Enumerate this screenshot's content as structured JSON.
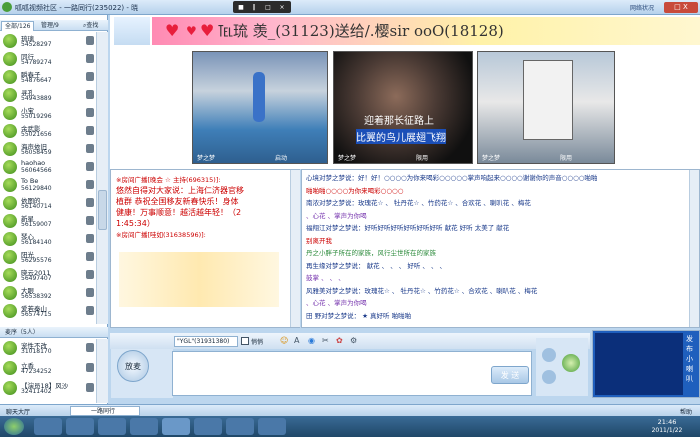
{
  "window": {
    "title": "呱呱视频社区 - 一路同行(235022) - 晓",
    "net_status": "网络状况",
    "max_label": "□ X"
  },
  "left_tabs": {
    "all": "全部/126",
    "manage": "管理/9",
    "search": "查找"
  },
  "users": [
    {
      "name": "琉璃",
      "id": "54528297"
    },
    {
      "name": "同行",
      "id": "54789274"
    },
    {
      "name": "瞬春子",
      "id": "54876647"
    },
    {
      "name": "寻孔",
      "id": "54943889"
    },
    {
      "name": "小宝",
      "id": "55019296"
    },
    {
      "name": "余武影",
      "id": "55021656"
    },
    {
      "name": "海声依旧",
      "id": "56058459"
    },
    {
      "name": "haohao",
      "id": "56064566"
    },
    {
      "name": "To Be",
      "id": "56129840"
    },
    {
      "name": "依图的",
      "id": "56140714"
    },
    {
      "name": "新星",
      "id": "56159007"
    },
    {
      "name": "琴心",
      "id": "56184140"
    },
    {
      "name": "阳光",
      "id": "56295576"
    },
    {
      "name": "晓云2011",
      "id": "56497407"
    },
    {
      "name": "大眼",
      "id": "56538392"
    },
    {
      "name": "爱若秦山",
      "id": "56574715"
    }
  ],
  "mic_section": {
    "title": "麦序（5人）"
  },
  "mic_users": [
    {
      "name": "宠性不改",
      "id": "31018170"
    },
    {
      "name": "立香",
      "id": "47234252"
    },
    {
      "name": "【演员18】风沙",
      "id": "32411402"
    }
  ],
  "banner": {
    "text": "℡琉 羡_(31123)送给/.樱sir ooO(18128)"
  },
  "videos": [
    {
      "label": "梦之梦",
      "status": "启动"
    },
    {
      "label": "梦之梦",
      "status": "限用"
    },
    {
      "label": "梦之梦",
      "status": "限用"
    }
  ],
  "video_caption": {
    "line1": "迎着那长征路上",
    "line2": "比翼的鸟儿展翅飞翔"
  },
  "main_chat": [
    "※房间广播[晚会 ☆ 主持(696315)]:",
    "悠然自得对大家说：上海仁济器官移",
    "植群 恭祝全国移友新春快乐！身体",
    "健康！万事顺意！越活越年轻！（2",
    "1:45:34）",
    "※房间广播[哇如(31638596)]:"
  ],
  "group_chat": [
    "心境对梦之梦说：好！好！○○○○为你来喝彩○○○○○掌声响起来○○○○谢谢你的声音○○○○啪啪",
    "啪啪啪○○○○为你来喝彩○○○○",
    "南浓对梦之梦说：玫瑰花☆ 、 牡丹花☆ 、竹药花☆ 、合欢花 、喇叭花 、梅花",
    " 、心花 、掌声为你喝",
    "福翔江对梦之梦说：好听好听好听好听好听好听 献花 好听 太美了 献花",
    "别离开我 ",
    "丹之小胖子所在的家族，风行尘世所在的家族",
    "再生缘对梦之梦说： 献花 、 、 、 好听 、 、 、",
    "鼓掌 、 、 、",
    "风雅美对梦之梦说：玫瑰花☆ 、 牡丹花☆ 、竹药花☆ 、合欢花 、喇叭花 、梅花",
    " 、心花 、掌声为你喝",
    "田 野对梦之梦说： ★ 真好听 啪啪啪"
  ],
  "toolbar": {
    "target": "\"YGL\"(31931380)",
    "checkbox": "悄悄"
  },
  "mic_button": "放麦",
  "send_button": "发 送",
  "ad_text": "发布小喇叭",
  "statusbar": {
    "hall": "聊天大厅",
    "room": "一路同行",
    "tail": "帮助"
  },
  "clock": {
    "time": "21:46",
    "date": "2011/1/22"
  },
  "colors": {
    "accent": "#bcd6ee",
    "red": "#cc0000",
    "taskbar": "#1f4768"
  }
}
